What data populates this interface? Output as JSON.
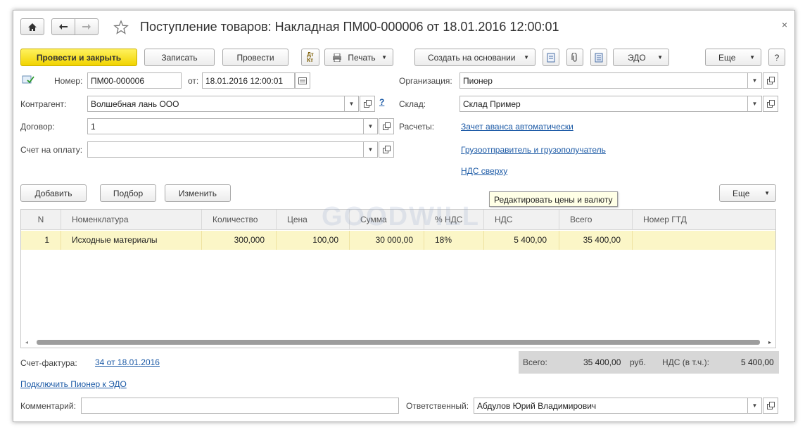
{
  "window": {
    "title": "Поступление товаров: Накладная ПМ00-000006 от 18.01.2016 12:00:01",
    "close": "×"
  },
  "toolbar": {
    "post_close": "Провести и закрыть",
    "save": "Записать",
    "post": "Провести",
    "print": "Печать",
    "create_based": "Создать на основании",
    "edo": "ЭДО",
    "more": "Еще",
    "help": "?"
  },
  "form": {
    "number_label": "Номер:",
    "number_value": "ПМ00-000006",
    "date_label": "от:",
    "date_value": "18.01.2016 12:00:01",
    "org_label": "Организация:",
    "org_value": "Пионер",
    "counterparty_label": "Контрагент:",
    "counterparty_value": "Волшебная лань ООО",
    "counterparty_help": "?",
    "warehouse_label": "Склад:",
    "warehouse_value": "Склад Пример",
    "contract_label": "Договор:",
    "contract_value": "1",
    "settlements_label": "Расчеты:",
    "settlements_link": "Зачет аванса автоматически",
    "invoice_label": "Счет на оплату:",
    "invoice_value": "",
    "shipper_link": "Грузоотправитель и грузополучатель",
    "vat_link": "НДС сверху"
  },
  "table_toolbar": {
    "add": "Добавить",
    "select": "Подбор",
    "change": "Изменить",
    "more": "Еще"
  },
  "tooltip": "Редактировать цены и валюту",
  "watermark": "GOODWILL",
  "table": {
    "headers": [
      "N",
      "Номенклатура",
      "Количество",
      "Цена",
      "Сумма",
      "% НДС",
      "НДС",
      "Всего",
      "Номер ГТД"
    ],
    "rows": [
      {
        "n": "1",
        "item": "Исходные материалы",
        "qty": "300,000",
        "price": "100,00",
        "sum": "30 000,00",
        "vat_rate": "18%",
        "vat": "5 400,00",
        "total": "35 400,00",
        "gtd": ""
      }
    ]
  },
  "footer": {
    "invoice_doc_label": "Счет-фактура:",
    "invoice_doc_link": "34 от 18.01.2016",
    "edo_link": "Подключить Пионер к ЭДО",
    "comment_label": "Комментарий:",
    "comment_value": "",
    "responsible_label": "Ответственный:",
    "responsible_value": "Абдулов Юрий Владимирович",
    "total_label": "Всего:",
    "total_value": "35 400,00",
    "currency": "руб.",
    "vat_label": "НДС (в т.ч.):",
    "vat_value": "5 400,00"
  }
}
